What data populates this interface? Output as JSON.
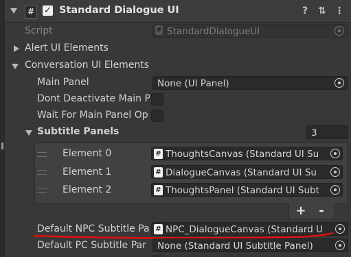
{
  "component": {
    "title": "Standard Dialogue UI",
    "enabled": true,
    "hash_glyph": "#",
    "check_glyph": "✓",
    "help_glyph": "?",
    "settings_glyph": "⇅",
    "more_glyph": "⋮"
  },
  "script_field": {
    "label": "Script",
    "value": "StandardDialogueUI"
  },
  "sections": {
    "alert": "Alert UI Elements",
    "conversation": "Conversation UI Elements"
  },
  "fields": {
    "main_panel": {
      "label": "Main Panel",
      "value": "None (UI Panel)"
    },
    "dont_deactivate": {
      "label": "Dont Deactivate Main P"
    },
    "wait_for_main": {
      "label": "Wait For Main Panel Op"
    },
    "subtitle_panels": {
      "label": "Subtitle Panels",
      "count": "3"
    },
    "default_npc": {
      "label": "Default NPC Subtitle Pa",
      "value": "NPC_DialogueCanvas (Standard U"
    },
    "default_pc": {
      "label": "Default PC Subtitle Par",
      "value": "None (Standard UI Subtitle Panel)"
    }
  },
  "elements": [
    {
      "label": "Element 0",
      "value": "ThoughtsCanvas (Standard UI Su"
    },
    {
      "label": "Element 1",
      "value": "DialogueCanvas (Standard UI Su"
    },
    {
      "label": "Element 2",
      "value": "ThoughtsPanel (Standard UI Subt"
    }
  ],
  "list_controls": {
    "add": "+",
    "remove": "-"
  },
  "colors": {
    "background": "#383838",
    "header": "#3c3c3c",
    "field": "#2a2a2a",
    "annotation": "#e01010"
  },
  "icons": [
    "script-icon",
    "checkbox-icon",
    "help-icon",
    "presets-icon",
    "more-icon",
    "object-picker-icon",
    "drag-handle-icon",
    "foldout-arrow-icon"
  ]
}
